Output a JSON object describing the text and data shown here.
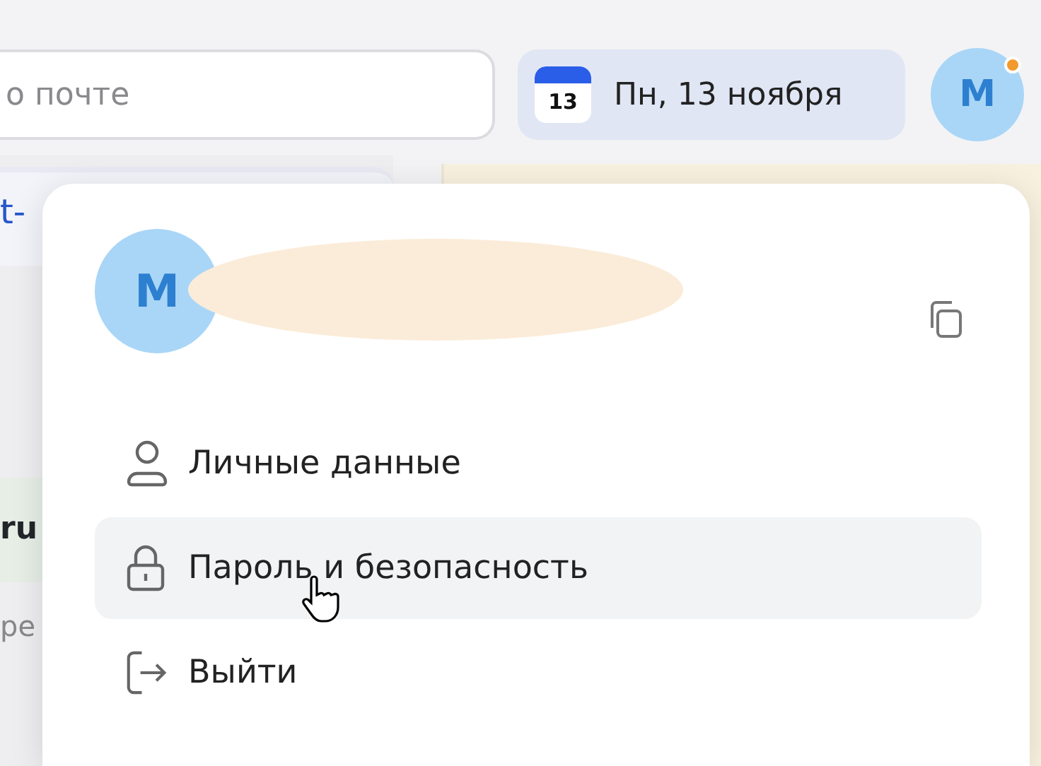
{
  "header": {
    "search": {
      "value": "о почте"
    },
    "date_button": {
      "label": "Пн, 13 ноября",
      "calendar_day": "13"
    },
    "avatar": {
      "letter": "М",
      "notification": true
    }
  },
  "background": {
    "link_fragment": "t-",
    "bold_fragment": "ru",
    "gray_fragment": "ре"
  },
  "profile_menu": {
    "avatar_letter": "М",
    "redacted": true,
    "items": [
      {
        "kind": "person",
        "label": "Личные данные",
        "selected": false
      },
      {
        "kind": "lock",
        "label": "Пароль и безопасность",
        "selected": true
      },
      {
        "kind": "logout",
        "label": "Выйти",
        "selected": false
      }
    ]
  }
}
